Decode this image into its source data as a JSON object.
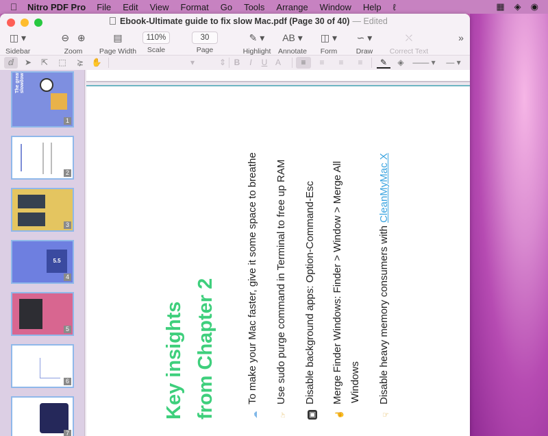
{
  "menubar": {
    "app_name": "Nitro PDF Pro",
    "items": [
      "File",
      "Edit",
      "View",
      "Format",
      "Go",
      "Tools",
      "Arrange",
      "Window",
      "Help"
    ]
  },
  "window": {
    "title": "Ebook-Ultimate guide to fix slow Mac.pdf (Page 30 of 40)",
    "status": "— Edited"
  },
  "toolbar": {
    "sidebar": "Sidebar",
    "zoom": "Zoom",
    "page_width": "Page Width",
    "scale": "Scale",
    "scale_value": "110%",
    "page": "Page",
    "page_value": "30",
    "highlight": "Highlight",
    "annotate": "Annotate",
    "annotate_glyph": "AB",
    "form": "Form",
    "draw": "Draw",
    "correct_text": "Correct Text"
  },
  "sidebar": {
    "thumbnails": [
      {
        "num": "1"
      },
      {
        "num": "2"
      },
      {
        "num": "3"
      },
      {
        "num": "4"
      },
      {
        "num": "5"
      },
      {
        "num": "6"
      },
      {
        "num": "7"
      }
    ],
    "thumb1_text": "The great slowdown",
    "thumb4_text": "5.5"
  },
  "document": {
    "heading_line1": "Key insights",
    "heading_line2": "from Chapter 2",
    "bullets": [
      "To make your Mac faster, give it some space to breathe",
      "Use sudo purge command in Terminal to free up RAM",
      "Disable background apps: Option-Command-Esc",
      "Merge Finder Windows: Finder > Window > Merge All",
      "Windows",
      "Disable heavy memory consumers with "
    ],
    "link_text": "CleanMyMac X"
  },
  "colors": {
    "heading": "#3ecf7c",
    "link": "#3aa4e0",
    "accent_border": "#8fb8ea"
  }
}
